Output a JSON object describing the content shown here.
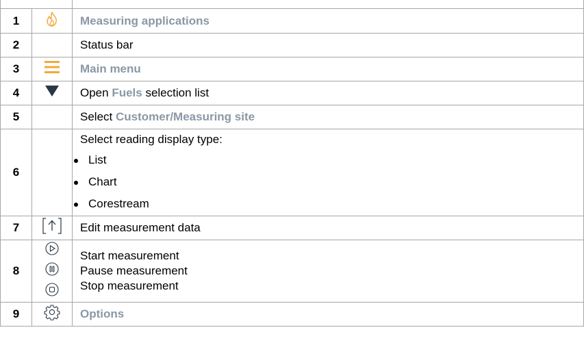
{
  "rows": [
    {
      "num": "1",
      "icon": "flame-icon",
      "text": "Measuring applications"
    },
    {
      "num": "2",
      "text": "Status bar"
    },
    {
      "num": "3",
      "icon": "menu-icon",
      "text": "Main menu"
    },
    {
      "num": "4",
      "icon": "triangle-down-icon",
      "pre": "Open ",
      "bold": "Fuels",
      "post": " selection list"
    },
    {
      "num": "5",
      "pre": "Select ",
      "bold": "Customer/Measuring site"
    },
    {
      "num": "6",
      "intro": "Select reading display type:",
      "items": [
        "List",
        "Chart",
        "Corestream"
      ]
    },
    {
      "num": "7",
      "icon": "upload-bracket-icon",
      "text": "Edit measurement data"
    },
    {
      "num": "8",
      "icons": [
        "play-circle-icon",
        "pause-circle-icon",
        "stop-circle-icon"
      ],
      "lines": [
        "Start measurement",
        "Pause measurement",
        "Stop measurement"
      ]
    },
    {
      "num": "9",
      "icon": "gear-icon",
      "text": "Options"
    }
  ],
  "colors": {
    "highlight": "#8a98a6",
    "accent_orange": "#f2a93b",
    "border": "#a6a6a6",
    "icon_dark": "#2b3744"
  }
}
